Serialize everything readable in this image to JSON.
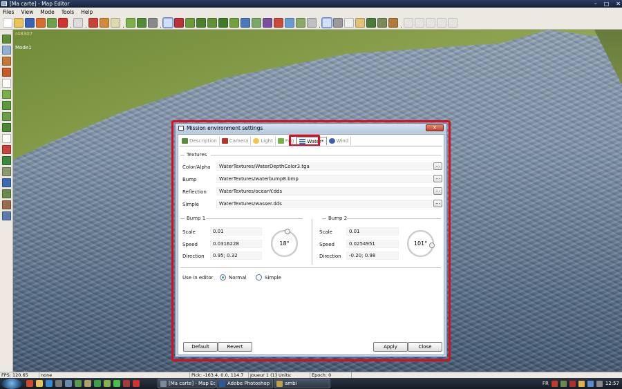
{
  "window": {
    "title": "[Ma carte] - Map Editor",
    "min": "–",
    "max": "□",
    "close": "✕"
  },
  "menu": [
    "Files",
    "View",
    "Mode",
    "Tools",
    "Help"
  ],
  "viewport": {
    "coord": "r48307",
    "mode": "Mode1"
  },
  "dialog": {
    "title": "Mission environment settings",
    "close_glyph": "✕",
    "tabs": [
      {
        "label": "Description",
        "color": "#5c8a3a"
      },
      {
        "label": "Camera",
        "color": "#b5332b"
      },
      {
        "label": "Light",
        "color": "#f1c53d"
      },
      {
        "label": "Fog",
        "color": "#7ab04a"
      },
      {
        "label": "Water*",
        "color": "#3a73c4"
      },
      {
        "label": "Wind",
        "color": "#3b62b0"
      }
    ],
    "textures": {
      "header": "Textures",
      "rows": [
        {
          "label": "Color/Alpha",
          "value": "WaterTextures/WaterDepthColor3.tga"
        },
        {
          "label": "Bump",
          "value": "WaterTextures/waterbump8.bmp"
        },
        {
          "label": "Reflection",
          "value": "WaterTextures/oceanY.dds"
        },
        {
          "label": "Simple",
          "value": "WaterTextures/wasser.dds"
        }
      ],
      "browse": "..."
    },
    "bump1": {
      "header": "Bump 1",
      "scale_label": "Scale",
      "scale": "0.01",
      "speed_label": "Speed",
      "speed": "0.0316228",
      "direction_label": "Direction",
      "direction": "0.95; 0.32",
      "angle": "18°"
    },
    "bump2": {
      "header": "Bump 2",
      "scale_label": "Scale",
      "scale": "0.01",
      "speed_label": "Speed",
      "speed": "0.0254951",
      "direction_label": "Direction",
      "direction": "-0.20; 0.98",
      "angle": "101°"
    },
    "editor": {
      "label": "Use in editor",
      "option_normal": "Normal",
      "option_simple": "Simple",
      "selected": "Normal"
    },
    "buttons": {
      "default": "Default",
      "revert": "Revert",
      "apply": "Apply",
      "close": "Close"
    }
  },
  "status": {
    "fps": "FPS: 120.65",
    "selection": "none",
    "pick": "Pick: -163.4, 0.0, 114.7",
    "player": "Joueur 1 (1)",
    "units": "Units:",
    "epoch": "Epoch: 0"
  },
  "taskbar": {
    "tasks": [
      "[Ma carte] - Map Ed...",
      "Adobe Photoshop",
      "ambi"
    ],
    "lang": "FR",
    "clock": "12:57"
  },
  "colors": {
    "highlight": "#d6101c",
    "accent": "#3a73c4"
  }
}
